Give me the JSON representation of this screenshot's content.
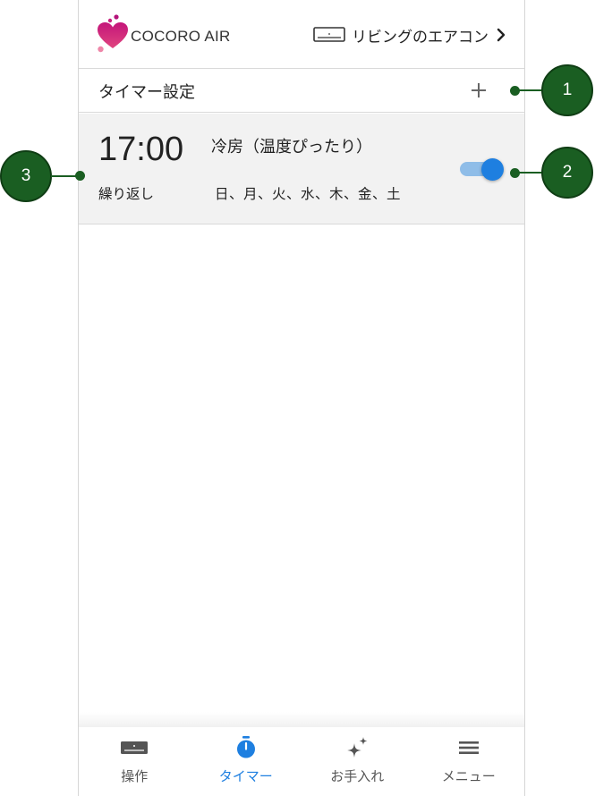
{
  "header": {
    "brand": "COCORO AIR",
    "device_name": "リビングのエアコン"
  },
  "timer_section": {
    "title": "タイマー設定"
  },
  "timer_item": {
    "time": "17:00",
    "mode": "冷房（温度ぴったり）",
    "repeat_label": "繰り返し",
    "days": "日、月、火、水、木、金、土",
    "enabled": true
  },
  "bottom_nav": {
    "items": [
      {
        "label": "操作",
        "icon": "aircon-icon"
      },
      {
        "label": "タイマー",
        "icon": "timer-icon"
      },
      {
        "label": "お手入れ",
        "icon": "sparkle-icon"
      },
      {
        "label": "メニュー",
        "icon": "menu-icon"
      }
    ],
    "active_index": 1
  },
  "callouts": [
    "1",
    "2",
    "3"
  ],
  "colors": {
    "accent": "#1e7fe0",
    "toggle_track": "#8fbde8",
    "callout": "#1a5e22",
    "logo": "#d6247f"
  }
}
